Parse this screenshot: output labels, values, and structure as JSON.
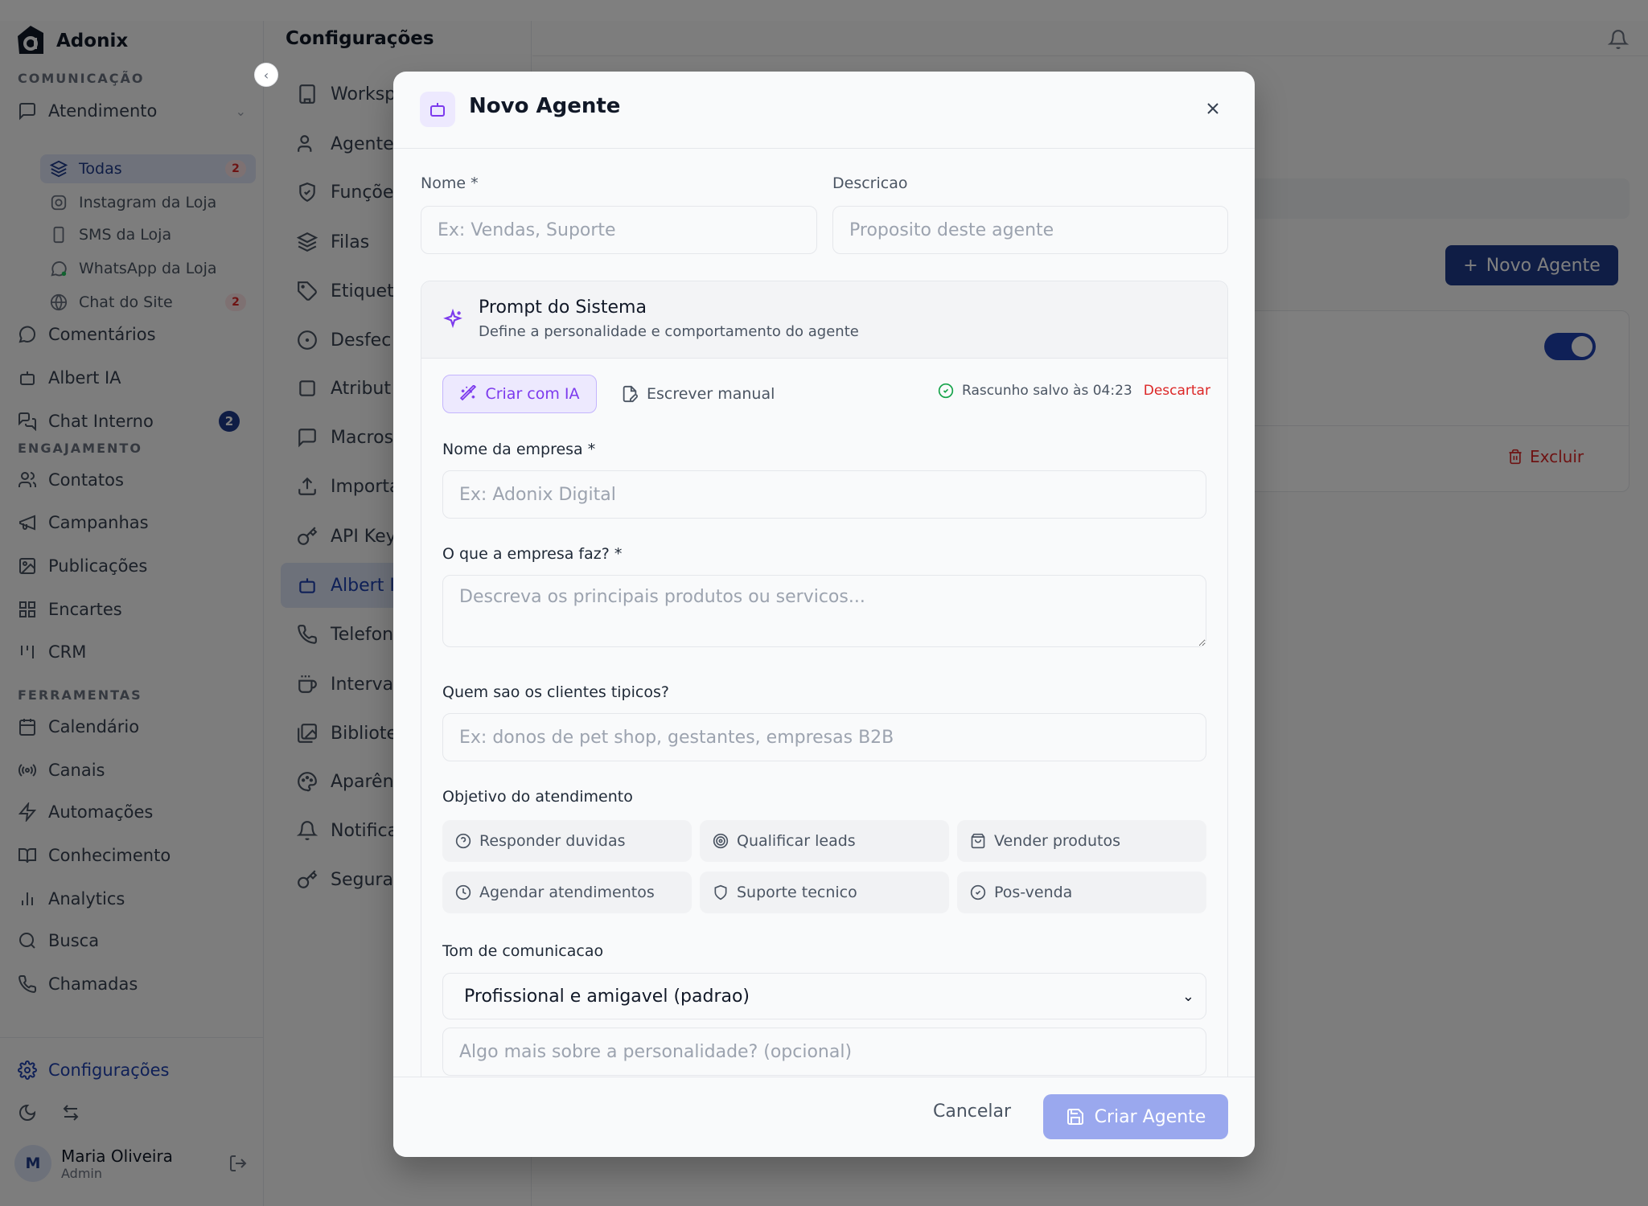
{
  "brand": {
    "name": "Adonix"
  },
  "sidebar": {
    "sections": {
      "comunicacao": "COMUNICAÇÃO",
      "engajamento": "ENGAJAMENTO",
      "ferramentas": "FERRAMENTAS"
    },
    "atendimento": {
      "label": "Atendimento",
      "subitems": [
        {
          "label": "Todas",
          "count": "2"
        },
        {
          "label": "Instagram da Loja"
        },
        {
          "label": "SMS da Loja"
        },
        {
          "label": "WhatsApp da Loja"
        },
        {
          "label": "Chat do Site",
          "count": "2"
        }
      ]
    },
    "comunicacao_items": [
      "Comentários",
      "Albert IA",
      "Chat Interno"
    ],
    "chat_interno_count": "2",
    "engajamento_items": [
      "Contatos",
      "Campanhas",
      "Publicações",
      "Encartes",
      "CRM"
    ],
    "ferramentas_items": [
      "Calendário",
      "Canais",
      "Automações",
      "Conhecimento",
      "Analytics",
      "Busca",
      "Chamadas"
    ],
    "configuracoes": "Configurações",
    "user": {
      "initial": "M",
      "name": "Maria Oliveira",
      "role": "Admin"
    }
  },
  "settings": {
    "title": "Configurações",
    "items": [
      "Worksp",
      "Agente",
      "Funçõe",
      "Filas",
      "Etiquet",
      "Desfec",
      "Atribut",
      "Macros",
      "Importa",
      "API Key",
      "Albert I",
      "Telefon",
      "Interva",
      "Bibliote",
      "Aparên",
      "Notifica",
      "Segura"
    ]
  },
  "main": {
    "novo_agente_btn": "Novo Agente",
    "excluir": "Excluir"
  },
  "modal": {
    "title": "Novo Agente",
    "nome_label": "Nome *",
    "nome_placeholder": "Ex: Vendas, Suporte",
    "descricao_label": "Descricao",
    "descricao_placeholder": "Proposito deste agente",
    "prompt": {
      "title": "Prompt do Sistema",
      "subtitle": "Define a personalidade e comportamento do agente",
      "tab_ia": "Criar com IA",
      "tab_manual": "Escrever manual",
      "draft_status": "Rascunho salvo às 04:23",
      "discard": "Descartar",
      "empresa_label": "Nome da empresa *",
      "empresa_placeholder": "Ex: Adonix Digital",
      "faz_label": "O que a empresa faz? *",
      "faz_placeholder": "Descreva os principais produtos ou servicos...",
      "clientes_label": "Quem sao os clientes tipicos?",
      "clientes_placeholder": "Ex: donos de pet shop, gestantes, empresas B2B",
      "objetivo_label": "Objetivo do atendimento",
      "objetivos": [
        "Responder duvidas",
        "Qualificar leads",
        "Vender produtos",
        "Agendar atendimentos",
        "Suporte tecnico",
        "Pos-venda"
      ],
      "tom_label": "Tom de comunicacao",
      "tom_value": "Profissional e amigavel (padrao)",
      "personalidade_placeholder": "Algo mais sobre a personalidade? (opcional)"
    },
    "cancel": "Cancelar",
    "create": "Criar Agente"
  },
  "colors": {
    "accent": "#1e3a8a",
    "purple": "#7c3aed",
    "danger": "#dc2626"
  }
}
